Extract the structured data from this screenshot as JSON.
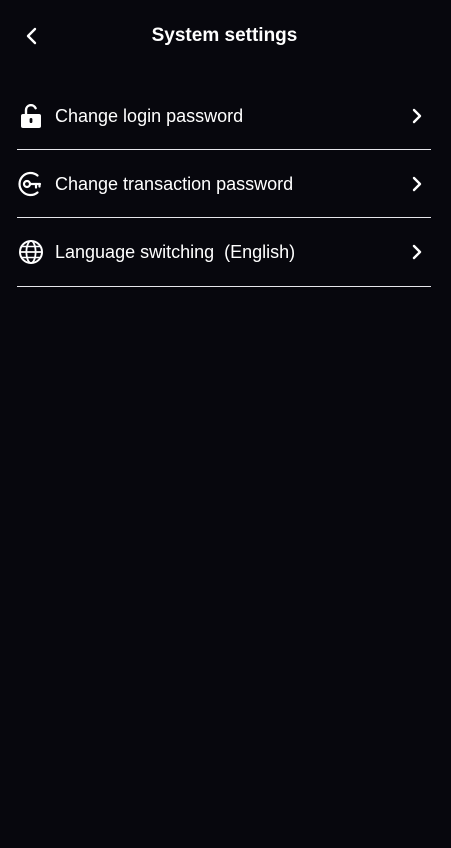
{
  "header": {
    "title": "System settings",
    "back_icon": "chevron-left-icon"
  },
  "menu": {
    "items": [
      {
        "label": "Change login password",
        "icon": "unlock-icon"
      },
      {
        "label": "Change transaction password",
        "icon": "key-circle-icon"
      },
      {
        "label": "Language switching  (English)",
        "icon": "globe-icon"
      }
    ],
    "chevron_icon": "chevron-right-icon"
  },
  "colors": {
    "background": "#07070d",
    "text": "#ffffff",
    "divider": "#e6e6ea"
  }
}
